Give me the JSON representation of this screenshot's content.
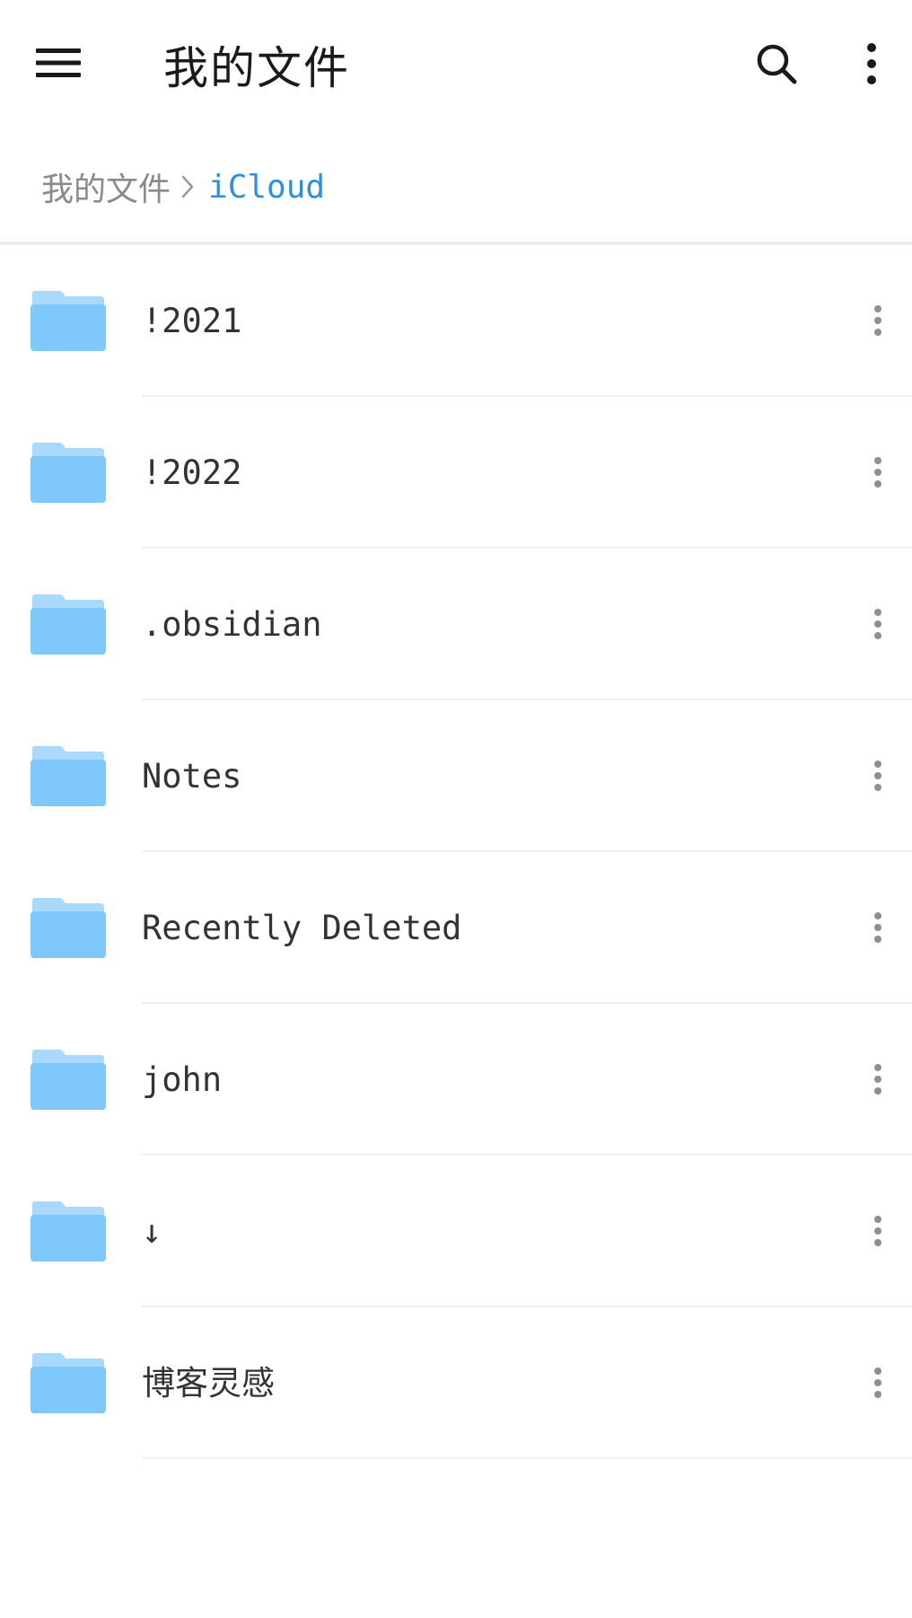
{
  "header": {
    "title": "我的文件"
  },
  "breadcrumb": {
    "root": "我的文件",
    "current": "iCloud"
  },
  "colors": {
    "accent": "#2f8fdc",
    "folder": "#7ec8fb",
    "folder_tab": "#a9dafd"
  },
  "folders": [
    {
      "name": "!2021"
    },
    {
      "name": "!2022"
    },
    {
      "name": ".obsidian"
    },
    {
      "name": "Notes"
    },
    {
      "name": "Recently Deleted"
    },
    {
      "name": "john"
    },
    {
      "name": "↓"
    },
    {
      "name": "博客灵感"
    }
  ]
}
